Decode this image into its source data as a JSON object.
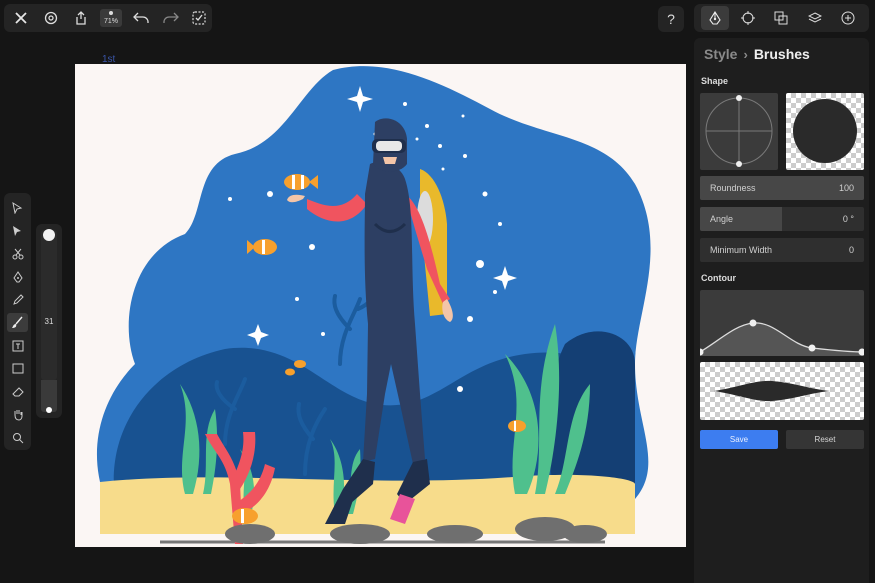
{
  "toolbar": {
    "icons": [
      "close-icon",
      "settings-icon",
      "share-icon",
      "zoom-indicator",
      "undo-icon",
      "redo-icon",
      "collapse-chevron-icon",
      "select-frame-icon"
    ],
    "zoom_label": "71%",
    "help_label": "?"
  },
  "canvas": {
    "artboard_label": "1st",
    "illustration": "scuba-diver-underwater-scene"
  },
  "tools": [
    "select-icon",
    "direct-select-icon",
    "scissors-icon",
    "pen-icon",
    "pencil-icon",
    "brush-icon",
    "text-icon",
    "rectangle-icon",
    "eraser-icon",
    "hand-icon",
    "zoom-icon"
  ],
  "brush_size": {
    "value": "31",
    "level": 0.31
  },
  "panel": {
    "tabs": [
      "style-tab-icon",
      "transform-tab-icon",
      "path-ops-tab-icon",
      "layers-tab-icon",
      "add-tab-icon"
    ],
    "breadcrumb_parent": "Style",
    "breadcrumb_current": "Brushes",
    "shape_section": "Shape",
    "fields": [
      {
        "label": "Roundness",
        "value": "100",
        "level": 1.0
      },
      {
        "label": "Angle",
        "value": "0 °",
        "level": 0.5
      },
      {
        "label": "Minimum Width",
        "value": "0",
        "level": 0
      }
    ],
    "contour_section": "Contour",
    "save_label": "Save",
    "reset_label": "Reset"
  },
  "colors": {
    "accent": "#3d7df0",
    "scene_blue": "#2e76c3",
    "scene_dark_blue": "#185291",
    "sand": "#f7dc8b"
  }
}
